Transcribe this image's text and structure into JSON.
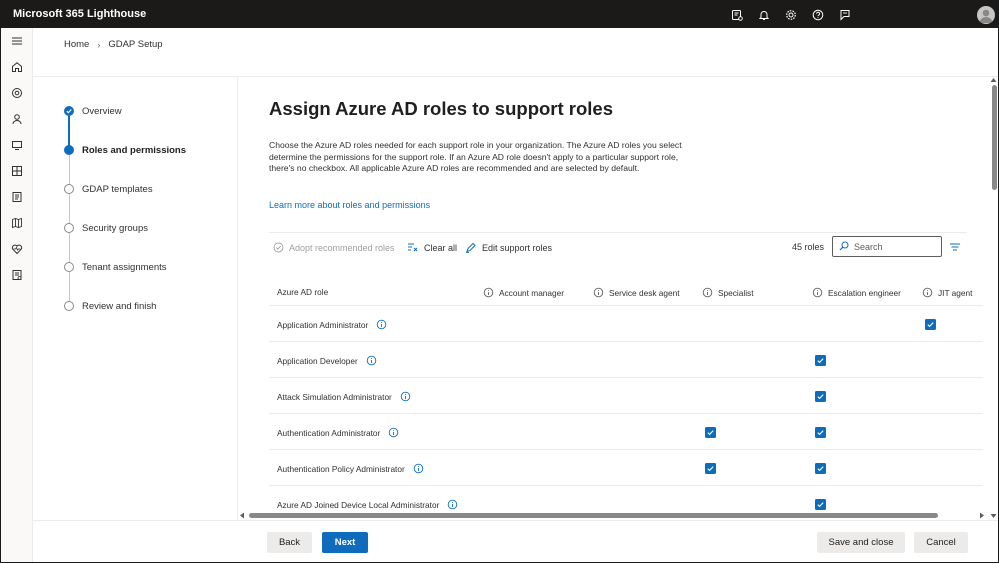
{
  "app": {
    "title": "Microsoft 365 Lighthouse"
  },
  "topbar": {
    "icons": [
      "feedback-icon",
      "bell-icon",
      "gear-icon",
      "help-icon",
      "person-feedback-icon"
    ]
  },
  "rail": {
    "icons": [
      "hamburger-icon",
      "home-icon",
      "tenants-icon",
      "users-icon",
      "devices-icon",
      "apps-icon",
      "reports-icon",
      "map-icon",
      "health-icon",
      "notes-icon"
    ]
  },
  "breadcrumb": {
    "home": "Home",
    "current": "GDAP Setup"
  },
  "steps": [
    {
      "label": "Overview",
      "state": "done"
    },
    {
      "label": "Roles and permissions",
      "state": "current"
    },
    {
      "label": "GDAP templates",
      "state": "todo"
    },
    {
      "label": "Security groups",
      "state": "todo"
    },
    {
      "label": "Tenant assignments",
      "state": "todo"
    },
    {
      "label": "Review and finish",
      "state": "todo"
    }
  ],
  "main": {
    "title": "Assign Azure AD roles to support roles",
    "description": "Choose the Azure AD roles needed for each support role in your organization. The Azure AD roles you select determine the permissions for the support role. If an Azure AD role doesn't apply to a particular support role, there's no checkbox. All applicable Azure AD roles are recommended and are selected by default.",
    "learn_more": "Learn more about roles and permissions"
  },
  "toolbar": {
    "adopt": "Adopt recommended roles",
    "clear": "Clear all",
    "edit": "Edit support roles",
    "count": "45 roles",
    "search_placeholder": "Search"
  },
  "table": {
    "role_header": "Azure AD role",
    "columns": [
      "Account manager",
      "Service desk agent",
      "Specialist",
      "Escalation engineer",
      "JIT agent"
    ],
    "rows": [
      {
        "name": "Application Administrator",
        "checked": [
          false,
          false,
          false,
          false,
          true
        ]
      },
      {
        "name": "Application Developer",
        "checked": [
          false,
          false,
          false,
          true,
          false
        ]
      },
      {
        "name": "Attack Simulation Administrator",
        "checked": [
          false,
          false,
          false,
          true,
          false
        ]
      },
      {
        "name": "Authentication Administrator",
        "checked": [
          false,
          false,
          true,
          true,
          false
        ]
      },
      {
        "name": "Authentication Policy Administrator",
        "checked": [
          false,
          false,
          true,
          true,
          false
        ]
      },
      {
        "name": "Azure AD Joined Device Local Administrator",
        "checked": [
          false,
          false,
          false,
          true,
          false
        ]
      }
    ]
  },
  "footer": {
    "back": "Back",
    "next": "Next",
    "save_close": "Save and close",
    "cancel": "Cancel"
  },
  "colors": {
    "accent": "#0f6cbd",
    "topbar": "#1b1a19"
  }
}
